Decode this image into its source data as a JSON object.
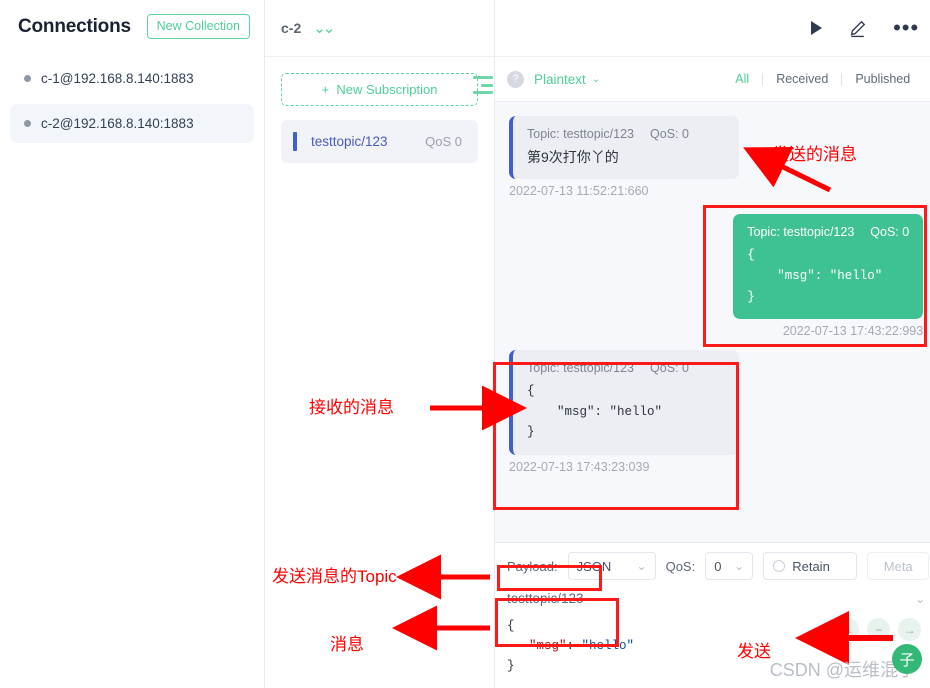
{
  "sidebar": {
    "title": "Connections",
    "new_collection_label": "New Collection",
    "connections": [
      {
        "label": "c-1@192.168.8.140:1883",
        "active": false
      },
      {
        "label": "c-2@192.168.8.140:1883",
        "active": true
      }
    ]
  },
  "subscriptions_panel": {
    "connection_name": "c-2",
    "new_subscription_label": "New Subscription",
    "items": [
      {
        "topic": "testtopic/123",
        "qos": "QoS 0"
      }
    ]
  },
  "main": {
    "format_selector": "Plaintext",
    "filters": [
      {
        "label": "All",
        "active": true
      },
      {
        "label": "Received",
        "active": false
      },
      {
        "label": "Published",
        "active": false
      }
    ],
    "messages": [
      {
        "direction": "received",
        "topic": "Topic: testtopic/123",
        "qos": "QoS: 0",
        "body": "第9次打你丫的",
        "timestamp": "2022-07-13 11:52:21:660"
      },
      {
        "direction": "published",
        "topic": "Topic: testtopic/123",
        "qos": "QoS: 0",
        "body": "{\n    \"msg\": \"hello\"\n}",
        "timestamp": "2022-07-13 17:43:22:993"
      },
      {
        "direction": "received",
        "topic": "Topic: testtopic/123",
        "qos": "QoS: 0",
        "body": "{\n    \"msg\": \"hello\"\n}",
        "timestamp": "2022-07-13 17:43:23:039"
      }
    ]
  },
  "publish_bar": {
    "payload_label": "Payload:",
    "payload_value": "JSON",
    "qos_label": "QoS:",
    "qos_value": "0",
    "retain_label": "Retain",
    "meta_label": "Meta",
    "topic_value": "testtopic/123",
    "editor_line1": "{",
    "editor_key": "\"msg\"",
    "editor_colon": ": ",
    "editor_value": "\"hello\"",
    "editor_line3": "}"
  },
  "annotations": {
    "sent_message": "发送的消息",
    "received_message": "接收的消息",
    "publish_topic": "发送消息的Topic",
    "message": "消息",
    "send": "发送"
  },
  "watermark": {
    "text": "CSDN @运维混子",
    "badge": "子"
  },
  "colors": {
    "accent_green": "#4fcf97",
    "bubble_send": "#3ec292",
    "annotation_red": "#ff0000",
    "subscription_blue": "#3f5fd0"
  }
}
